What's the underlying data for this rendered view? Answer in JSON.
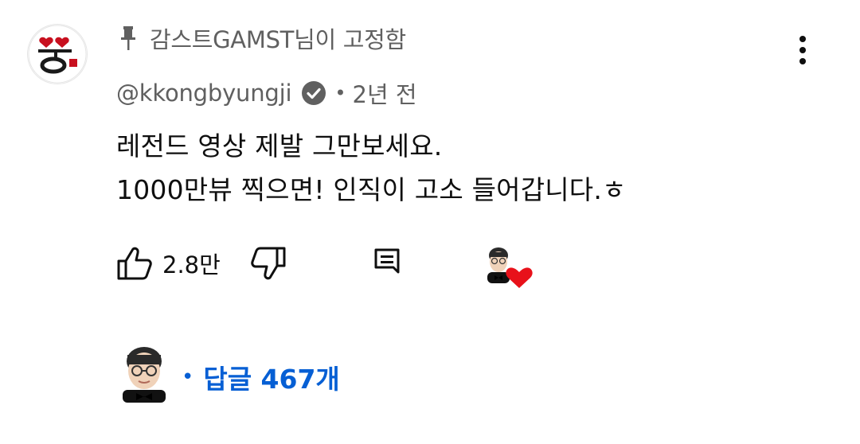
{
  "pinned": {
    "text": "감스트GAMST님이 고정함",
    "icon": "pin-icon"
  },
  "comment": {
    "author": "@kkongbyungji",
    "verified_icon": "verified-check-icon",
    "dot": "•",
    "time": "2년 전",
    "lines": [
      "레전드 영상 제발 그만보세요.",
      "1000만뷰 찍으면! 인직이 고소 들어갑니다.ㅎ"
    ]
  },
  "actions": {
    "like_count": "2.8만",
    "like_icon": "thumbs-up-icon",
    "dislike_icon": "thumbs-down-icon",
    "reply_icon": "reply-comment-icon",
    "creator_heart_icon": "creator-heart-icon"
  },
  "replies": {
    "dot": "•",
    "label": "답글 467개"
  },
  "colors": {
    "link_blue": "#065fd4",
    "secondary_text": "#606060",
    "heart_red": "#e8111a",
    "avatar_red": "#c8101f"
  }
}
